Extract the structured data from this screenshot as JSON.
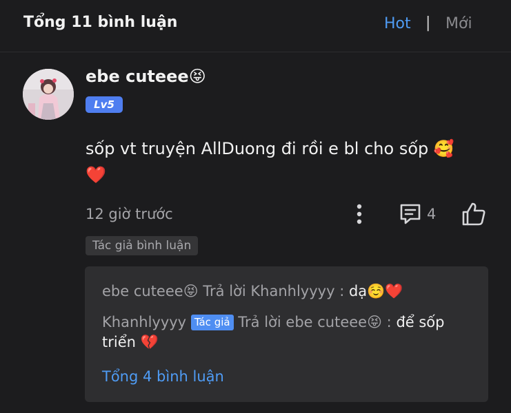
{
  "header": {
    "title": "Tổng 11 bình luận",
    "sort_hot": "Hot",
    "separator": "|",
    "sort_new": "Mới"
  },
  "comment": {
    "username": "ebe cuteee😝",
    "level": "Lv5",
    "text_line1": "sốp vt truyện AllDuong đi rồi e bl cho sốp 🥰",
    "text_line2": "❤️",
    "time": "12 giờ trước",
    "reply_count": "4",
    "author_label": "Tác giả bình luận"
  },
  "replies": {
    "reply1_user": "ebe cuteee😝",
    "reply1_action": "Trả lời",
    "reply1_target": "Khanhlyyyy :",
    "reply1_text": "dạ☺️❤️",
    "reply2_user": "Khanhlyyyy",
    "reply2_badge": "Tác giả",
    "reply2_action": "Trả lời",
    "reply2_target": "ebe cuteee😝 :",
    "reply2_text": "để sốp triển 💔",
    "total": "Tổng 4 bình luận"
  },
  "colors": {
    "accent": "#4f9cf5",
    "background": "#1c1c1e",
    "level_badge": "#4f7ef0"
  },
  "icons": {
    "more": "more-vertical-icon",
    "reply": "comment-icon",
    "like": "thumbs-up-icon"
  }
}
